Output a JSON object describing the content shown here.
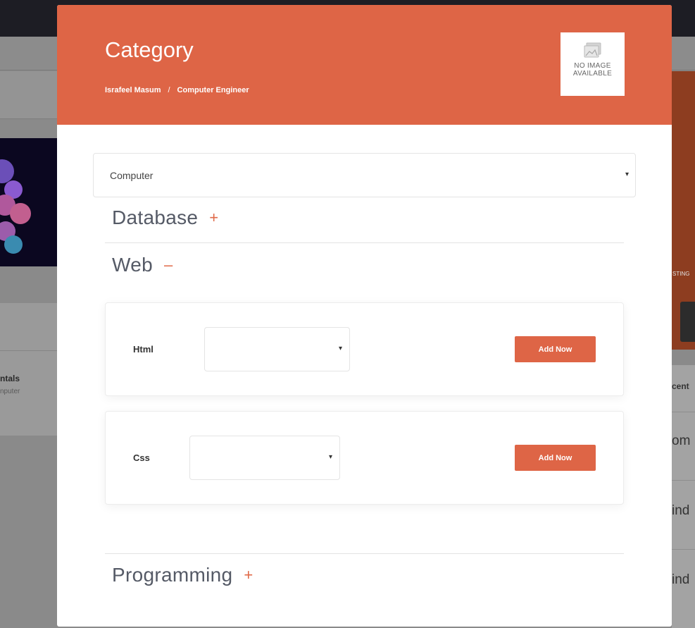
{
  "background": {
    "left_card_title": "ntals",
    "left_card_sub": "nputer",
    "right_banner_label": "STING",
    "right_list_heading": "cent",
    "right_list_items": [
      "om",
      "ind",
      "ind"
    ]
  },
  "modal": {
    "title": "Category",
    "breadcrumb": {
      "name": "Israfeel Masum",
      "separator": "/",
      "role": "Computer Engineer"
    },
    "image_placeholder": {
      "line1": "NO IMAGE",
      "line2": "AVAILABLE"
    },
    "category_select": {
      "value": "Computer",
      "caret": "▾"
    },
    "sections": [
      {
        "title": "Database",
        "toggle": "+"
      },
      {
        "title": "Web",
        "toggle": "–"
      },
      {
        "title": "Programming",
        "toggle": "+"
      }
    ],
    "web_items": [
      {
        "label": "Html",
        "select_value": "",
        "caret": "▾",
        "button": "Add Now"
      },
      {
        "label": "Css",
        "select_value": "",
        "caret": "▾",
        "button": "Add Now"
      }
    ]
  },
  "colors": {
    "accent": "#de6546",
    "toggle": "#e06a48",
    "heading": "#555a66"
  }
}
